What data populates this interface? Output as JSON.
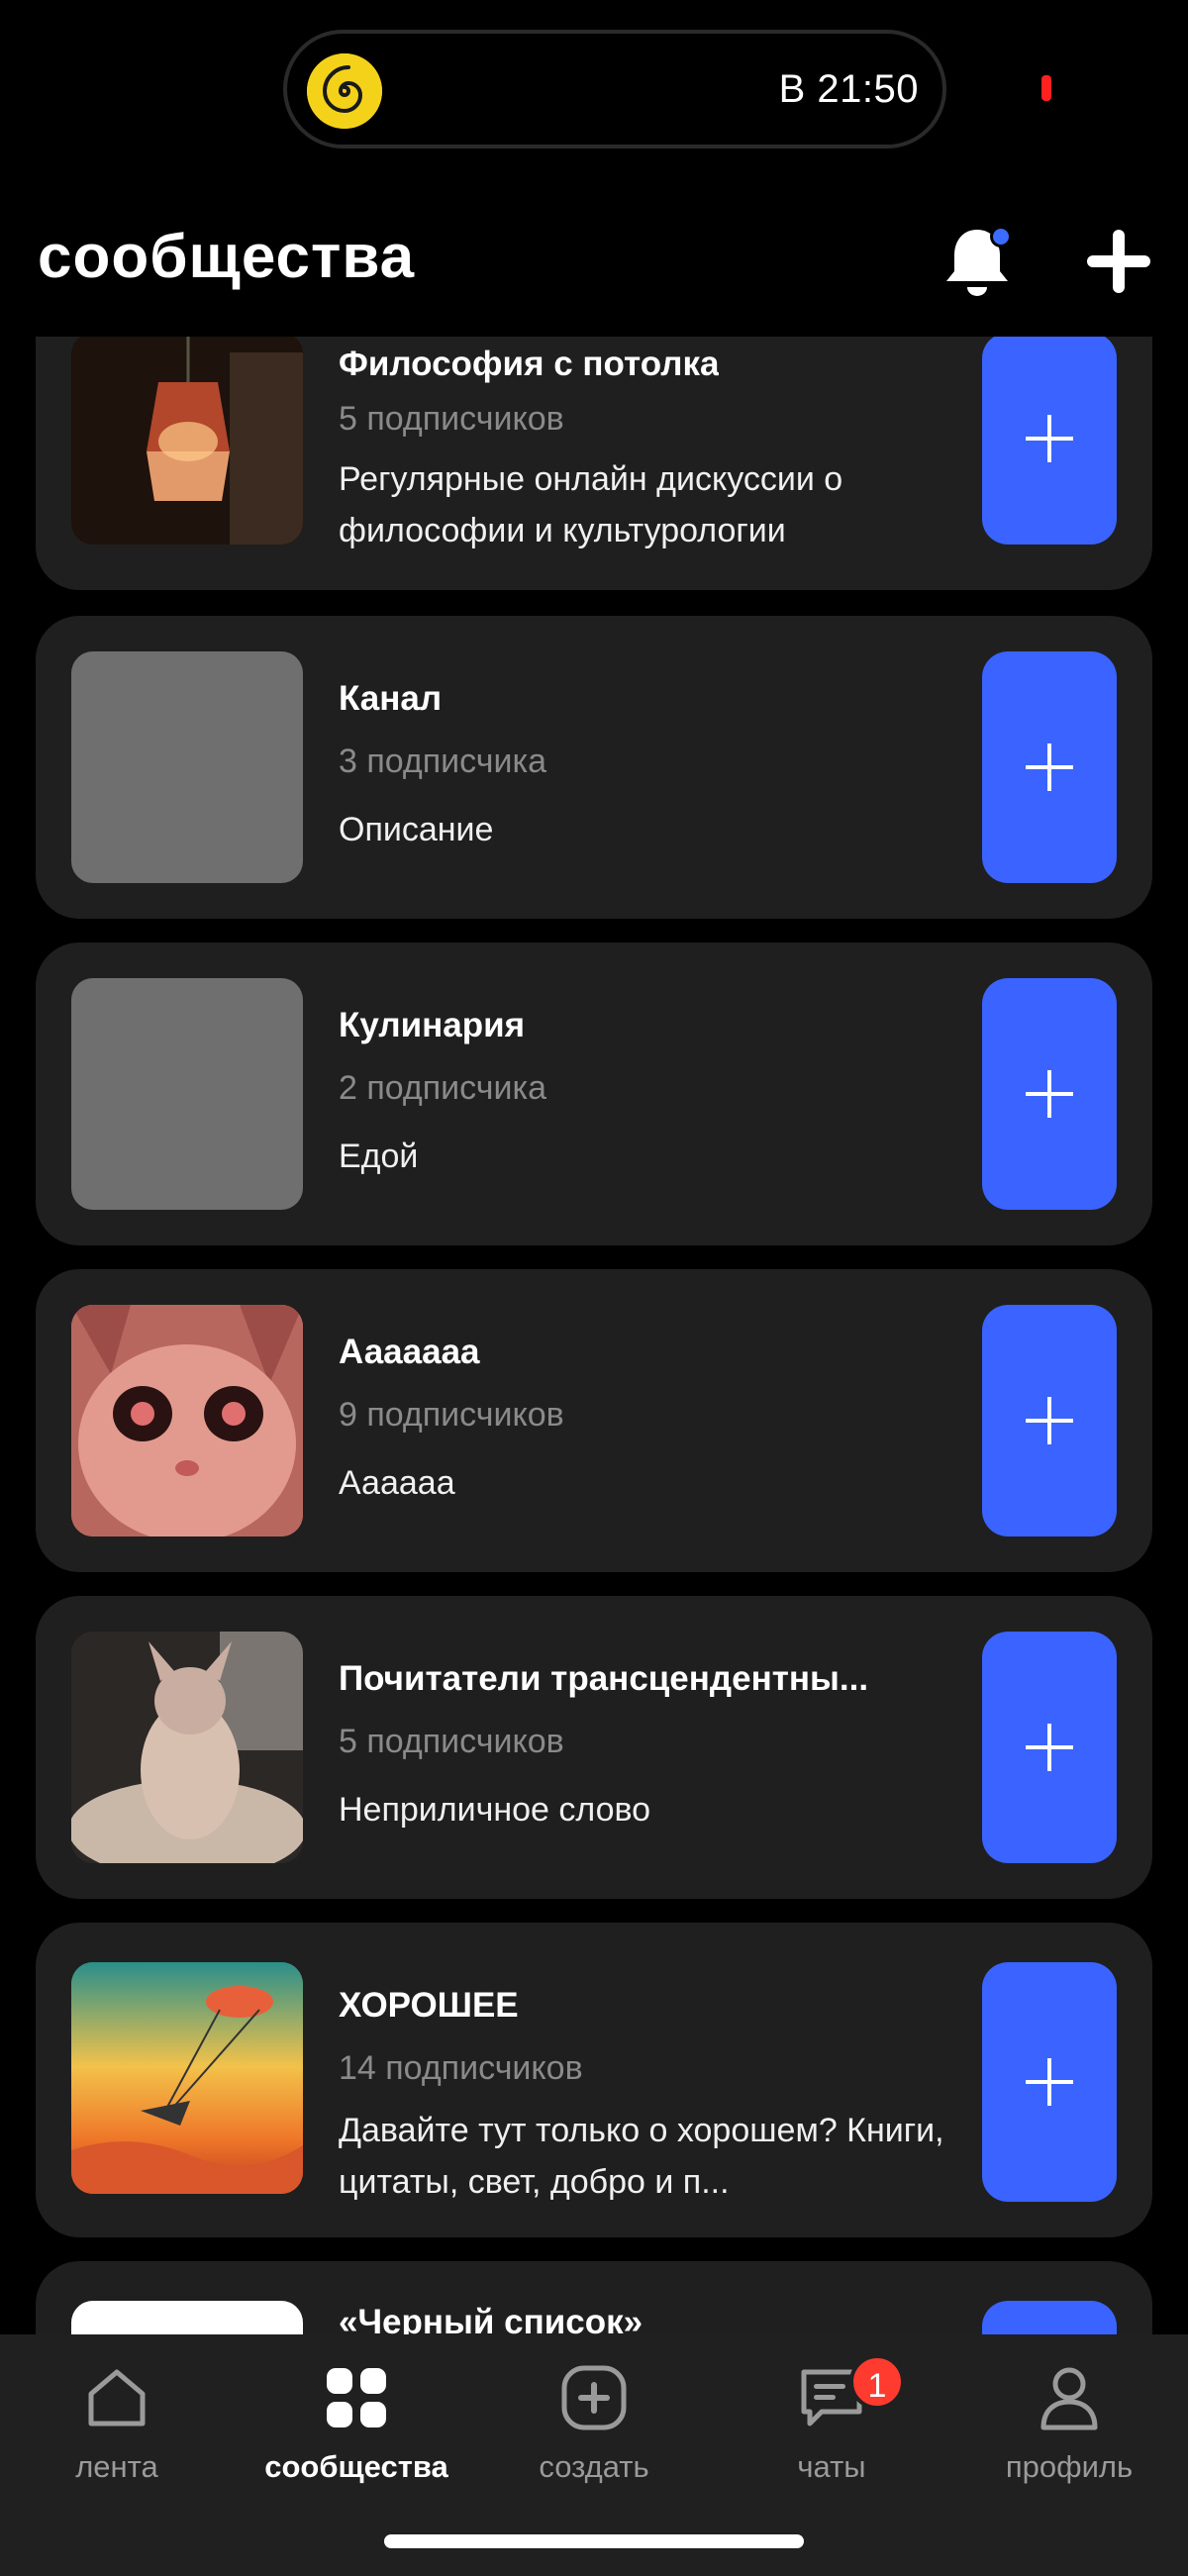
{
  "status_bar": {
    "time": "В 21:50",
    "app_icon": "spiral-logo-icon",
    "recording_color": "#ff2020"
  },
  "header": {
    "title": "сообщества",
    "notifications_icon": "bell-icon",
    "add_icon": "plus-icon"
  },
  "colors": {
    "accent": "#3a63ff",
    "card_bg": "#1f1f1f",
    "badge": "#ff3b30"
  },
  "communities": [
    {
      "title": "Философия с потолка",
      "subscribers": "5 подписчиков",
      "description": "Регулярные онлайн дискуссии о философии и культурологии",
      "thumb": "lamp-photo"
    },
    {
      "title": "Канал",
      "subscribers": "3 подписчика",
      "description": "Описание",
      "thumb": "placeholder"
    },
    {
      "title": "Кулинария",
      "subscribers": "2 подписчика",
      "description": "Едой",
      "thumb": "placeholder"
    },
    {
      "title": "Ааааааа",
      "subscribers": "9 подписчиков",
      "description": "Аааааа",
      "thumb": "pink-cat-photo"
    },
    {
      "title": "Почитатели трансцендентны...",
      "subscribers": "5 подписчиков",
      "description": "Неприличное слово",
      "thumb": "sphynx-cat-photo"
    },
    {
      "title": "ХОРОШЕЕ",
      "subscribers": "14 подписчиков",
      "description": "Давайте тут только о хорошем? Книги, цитаты, свет, добро и п...",
      "thumb": "sunset-paraglider-painting"
    },
    {
      "title": "«Черный список»",
      "subscribers": "",
      "description": "",
      "thumb": "white-logo"
    }
  ],
  "join_icon": "plus-icon",
  "tabbar": {
    "tabs": [
      {
        "label": "лента",
        "icon": "home-icon"
      },
      {
        "label": "сообщества",
        "icon": "grid-icon",
        "active": true
      },
      {
        "label": "создать",
        "icon": "add-square-icon"
      },
      {
        "label": "чаты",
        "icon": "chat-icon",
        "badge": "1"
      },
      {
        "label": "профиль",
        "icon": "user-icon"
      }
    ]
  }
}
